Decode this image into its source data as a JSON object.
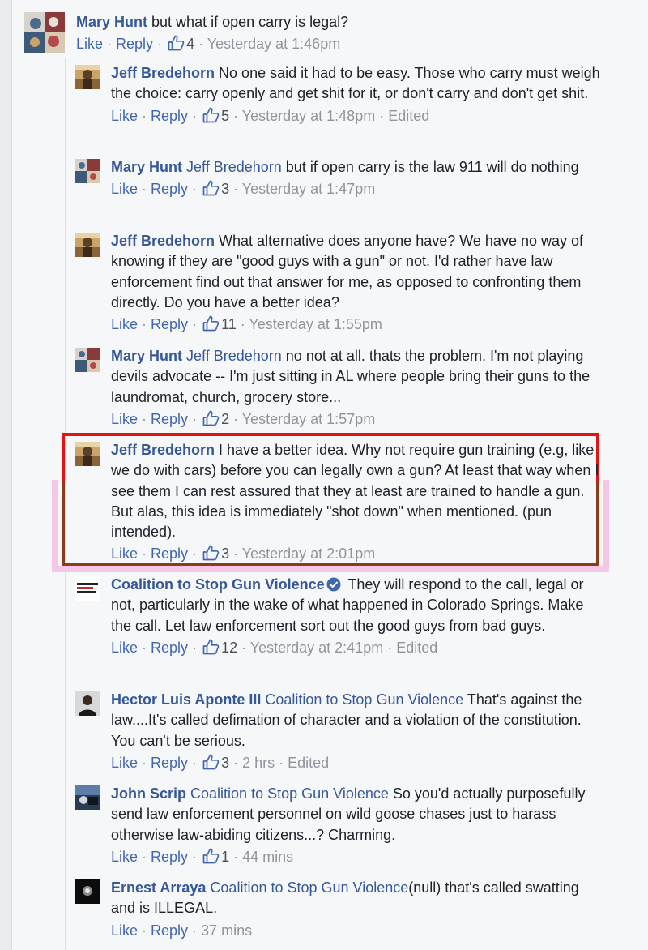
{
  "comments": [
    {
      "author": "Mary Hunt",
      "text": "but what if open carry is legal?",
      "actions": {
        "like": "Like",
        "reply": "Reply",
        "likes": "4",
        "time": "Yesterday at 1:46pm"
      }
    },
    {
      "author": "Jeff Bredehorn",
      "text": "No one said it had to be easy. Those who carry must weigh the choice: carry openly and get shit for it, or don't carry and don't get shit.",
      "actions": {
        "like": "Like",
        "reply": "Reply",
        "likes": "5",
        "time": "Yesterday at 1:48pm",
        "edited": "Edited"
      }
    },
    {
      "author": "Mary Hunt",
      "tag": "Jeff Bredehorn",
      "text": "but if open carry is the law 911 will do nothing",
      "actions": {
        "like": "Like",
        "reply": "Reply",
        "likes": "3",
        "time": "Yesterday at 1:47pm"
      }
    },
    {
      "author": "Jeff Bredehorn",
      "text": "What alternative does anyone have? We have no way of knowing if they are \"good guys with a gun\" or not. I'd rather have law enforcement find out that answer for me, as opposed to confronting them directly. Do you have a better idea?",
      "actions": {
        "like": "Like",
        "reply": "Reply",
        "likes": "11",
        "time": "Yesterday at 1:55pm"
      }
    },
    {
      "author": "Mary Hunt",
      "tag": "Jeff Bredehorn",
      "text": "no not at all. thats the problem. I'm not playing devils advocate -- I'm just sitting in AL where people bring their guns to the laundromat, church, grocery store...",
      "actions": {
        "like": "Like",
        "reply": "Reply",
        "likes": "2",
        "time": "Yesterday at 1:57pm"
      }
    },
    {
      "author": "Jeff Bredehorn",
      "text": "I have a better idea. Why not require gun training (e.g, like we do with cars) before you can legally own a gun? At least that way when I see them I can rest assured that they at least are trained to handle a gun. But alas, this idea is immediately \"shot down\" when mentioned. (pun intended).",
      "actions": {
        "like": "Like",
        "reply": "Reply",
        "likes": "3",
        "time": "Yesterday at 2:01pm"
      }
    },
    {
      "author": "Coalition to Stop Gun Violence",
      "text": "They will respond to the call, legal or not, particularly in the wake of what happened in Colorado Springs. Make the call. Let law enforcement sort out the good guys from bad guys.",
      "actions": {
        "like": "Like",
        "reply": "Reply",
        "likes": "12",
        "time": "Yesterday at 2:41pm",
        "edited": "Edited"
      }
    },
    {
      "author": "Hector Luis Aponte III",
      "tag": "Coalition to Stop Gun Violence",
      "text": "That's against the law....It's called defimation of character and a violation of the constitution. You can't be serious.",
      "actions": {
        "like": "Like",
        "reply": "Reply",
        "likes": "3",
        "time": "2 hrs",
        "edited": "Edited"
      }
    },
    {
      "author": "John Scrip",
      "tag": "Coalition to Stop Gun Violence",
      "text": "So you'd actually purposefully send law enforcement personnel on wild goose chases just to harass otherwise law-abiding citizens...? Charming.",
      "actions": {
        "like": "Like",
        "reply": "Reply",
        "likes": "1",
        "time": "44 mins"
      }
    },
    {
      "author": "Ernest Arraya",
      "tag": "Coalition to Stop Gun Violence",
      "text": "(null) that's called swatting and is ILLEGAL.",
      "actions": {
        "like": "Like",
        "reply": "Reply",
        "time": "37 mins"
      }
    }
  ],
  "colors": {
    "author": "#365899",
    "link": "#4267b2",
    "meta": "#90949c",
    "highlight_border": "#e11313",
    "highlight_border_lower": "#8e3a1d",
    "highlight_glow": "#f6c6e6"
  }
}
